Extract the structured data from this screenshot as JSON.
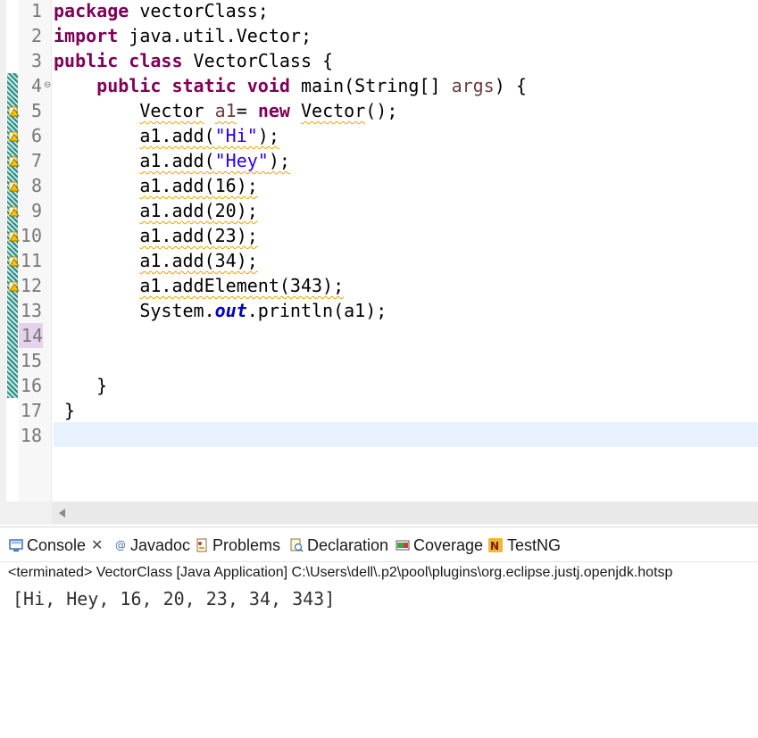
{
  "editor": {
    "line_numbers": [
      "1",
      "2",
      "3",
      "4",
      "5",
      "6",
      "7",
      "8",
      "9",
      "10",
      "11",
      "12",
      "13",
      "14",
      "15",
      "16",
      "17",
      "18"
    ],
    "lines": [
      [
        {
          "t": "package",
          "c": "kw"
        },
        {
          "t": " vectorClass;"
        }
      ],
      [
        {
          "t": "import",
          "c": "kw"
        },
        {
          "t": " java.util.Vector;"
        }
      ],
      [
        {
          "t": "public",
          "c": "kw"
        },
        {
          "t": " "
        },
        {
          "t": "class",
          "c": "kw"
        },
        {
          "t": " VectorClass {"
        }
      ],
      [
        {
          "t": "    "
        },
        {
          "t": "public",
          "c": "kw"
        },
        {
          "t": " "
        },
        {
          "t": "static",
          "c": "kw"
        },
        {
          "t": " "
        },
        {
          "t": "void",
          "c": "kw"
        },
        {
          "t": " main(String[] "
        },
        {
          "t": "args",
          "c": "unused"
        },
        {
          "t": ") {"
        }
      ],
      [
        {
          "t": "        "
        },
        {
          "t": "Vector",
          "c": "warn"
        },
        {
          "t": " "
        },
        {
          "t": "a1",
          "c": "unused warn"
        },
        {
          "t": "= "
        },
        {
          "t": "new",
          "c": "kw"
        },
        {
          "t": " "
        },
        {
          "t": "Vector",
          "c": "warn"
        },
        {
          "t": "();"
        }
      ],
      [
        {
          "t": "        "
        },
        {
          "t": "a1.add(",
          "c": "warn"
        },
        {
          "t": "\"Hi\"",
          "c": "str warn"
        },
        {
          "t": ");",
          "c": "warn"
        }
      ],
      [
        {
          "t": "        "
        },
        {
          "t": "a1.add(",
          "c": "warn"
        },
        {
          "t": "\"Hey\"",
          "c": "str warn"
        },
        {
          "t": ");",
          "c": "warn"
        }
      ],
      [
        {
          "t": "        "
        },
        {
          "t": "a1.add(16);",
          "c": "warn"
        }
      ],
      [
        {
          "t": "        "
        },
        {
          "t": "a1.add(20);",
          "c": "warn"
        }
      ],
      [
        {
          "t": "        "
        },
        {
          "t": "a1.add(23);",
          "c": "warn"
        }
      ],
      [
        {
          "t": "        "
        },
        {
          "t": "a1.add(34);",
          "c": "warn"
        }
      ],
      [
        {
          "t": "        "
        },
        {
          "t": "a1.addElement(343);",
          "c": "warn"
        }
      ],
      [
        {
          "t": "        System."
        },
        {
          "t": "out",
          "c": "fld"
        },
        {
          "t": ".println(a1);"
        }
      ],
      [
        {
          "t": ""
        }
      ],
      [
        {
          "t": ""
        }
      ],
      [
        {
          "t": "    }"
        }
      ],
      [
        {
          "t": " }"
        }
      ],
      [
        {
          "t": ""
        }
      ]
    ],
    "fold_symbol": "⊖",
    "warning_lines": [
      5,
      6,
      7,
      8,
      9,
      10,
      11,
      12
    ],
    "changed_lines": [
      4,
      5,
      6,
      7,
      8,
      9,
      10,
      11,
      12,
      13,
      14,
      15,
      16
    ],
    "highlighted_line": 14,
    "cursor_line": 18
  },
  "console": {
    "tabs": [
      {
        "label": "Console",
        "icon": "console-icon",
        "close": "✕"
      },
      {
        "label": "Javadoc",
        "icon": "javadoc-icon"
      },
      {
        "label": "Problems",
        "icon": "problems-icon"
      },
      {
        "label": "Declaration",
        "icon": "declaration-icon"
      },
      {
        "label": "Coverage",
        "icon": "coverage-icon"
      },
      {
        "label": "TestNG",
        "icon": "testng-icon"
      }
    ],
    "status": "<terminated> VectorClass [Java Application] C:\\Users\\dell\\.p2\\pool\\plugins\\org.eclipse.justj.openjdk.hotsp",
    "output": "[Hi, Hey, 16, 20, 23, 34, 343]"
  }
}
